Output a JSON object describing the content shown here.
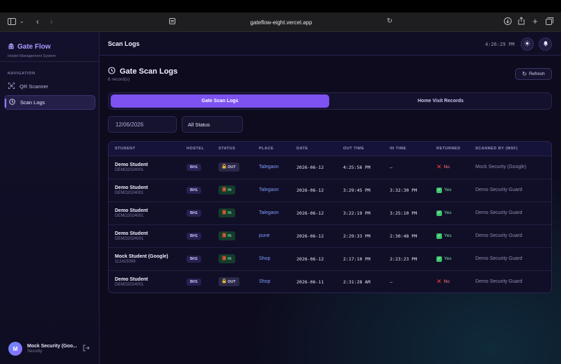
{
  "browser": {
    "url": "gateflow-eight.vercel.app"
  },
  "sidebar": {
    "brand_title": "Gate Flow",
    "brand_subtitle": "Hostel Management System",
    "nav_heading": "NAVIGATION",
    "items": [
      {
        "label": "QR Scanner",
        "icon": "qr-scan-icon",
        "active": false
      },
      {
        "label": "Scan Logs",
        "icon": "history-icon",
        "active": true
      }
    ],
    "user": {
      "initial": "M",
      "name": "Mock Security (Goo...",
      "role": "Security"
    }
  },
  "header": {
    "title": "Scan Logs",
    "time": "4:26:29 PM"
  },
  "page": {
    "title": "Gate Scan Logs",
    "record_count": "6 record(s)",
    "refresh_label": "Refresh",
    "tabs": [
      {
        "label": "Gate Scan Logs",
        "active": true
      },
      {
        "label": "Home Visit Records",
        "active": false
      }
    ],
    "date_filter": "12/06/2026",
    "status_filter": "All Status"
  },
  "table": {
    "columns": [
      "STUDENT",
      "HOSTEL",
      "STATUS",
      "PLACE",
      "DATE",
      "OUT TIME",
      "IN TIME",
      "RETURNED",
      "SCANNED BY (MSF)"
    ],
    "rows": [
      {
        "name": "Demo Student",
        "id": "DEMO2024001",
        "hostel": "BH1",
        "status": "OUT",
        "place": "Talegaon",
        "date": "2026-06-12",
        "out_time": "4:25:56 PM",
        "in_time": "—",
        "returned": "No",
        "scanned_by": "Mock Security (Google)"
      },
      {
        "name": "Demo Student",
        "id": "DEMO2024001",
        "hostel": "BH1",
        "status": "IN",
        "place": "Talegaon",
        "date": "2026-06-12",
        "out_time": "3:29:45 PM",
        "in_time": "3:32:30 PM",
        "returned": "Yes",
        "scanned_by": "Demo Security Guard"
      },
      {
        "name": "Demo Student",
        "id": "DEMO2024001",
        "hostel": "BH1",
        "status": "IN",
        "place": "Talegaon",
        "date": "2026-06-12",
        "out_time": "3:22:19 PM",
        "in_time": "3:25:10 PM",
        "returned": "Yes",
        "scanned_by": "Demo Security Guard"
      },
      {
        "name": "Demo Student",
        "id": "DEMO2024001",
        "hostel": "BH1",
        "status": "IN",
        "place": "pune",
        "date": "2026-06-12",
        "out_time": "2:29:33 PM",
        "in_time": "2:30:48 PM",
        "returned": "Yes",
        "scanned_by": "Demo Security Guard"
      },
      {
        "name": "Mock Student (Google)",
        "id": "112415099",
        "hostel": "BH1",
        "status": "IN",
        "place": "Shop",
        "date": "2026-06-12",
        "out_time": "2:17:10 PM",
        "in_time": "2:23:23 PM",
        "returned": "Yes",
        "scanned_by": "Demo Security Guard"
      },
      {
        "name": "Demo Student",
        "id": "DEMO2024001",
        "hostel": "BH1",
        "status": "OUT",
        "place": "Shop",
        "date": "2026-06-11",
        "out_time": "2:31:28 AM",
        "in_time": "—",
        "returned": "No",
        "scanned_by": "Demo Security Guard"
      }
    ]
  },
  "colors": {
    "accent": "#7d52f0",
    "brand": "#a69bff",
    "in_status": "#5fd49a",
    "returned_no": "#ff3b3b"
  }
}
